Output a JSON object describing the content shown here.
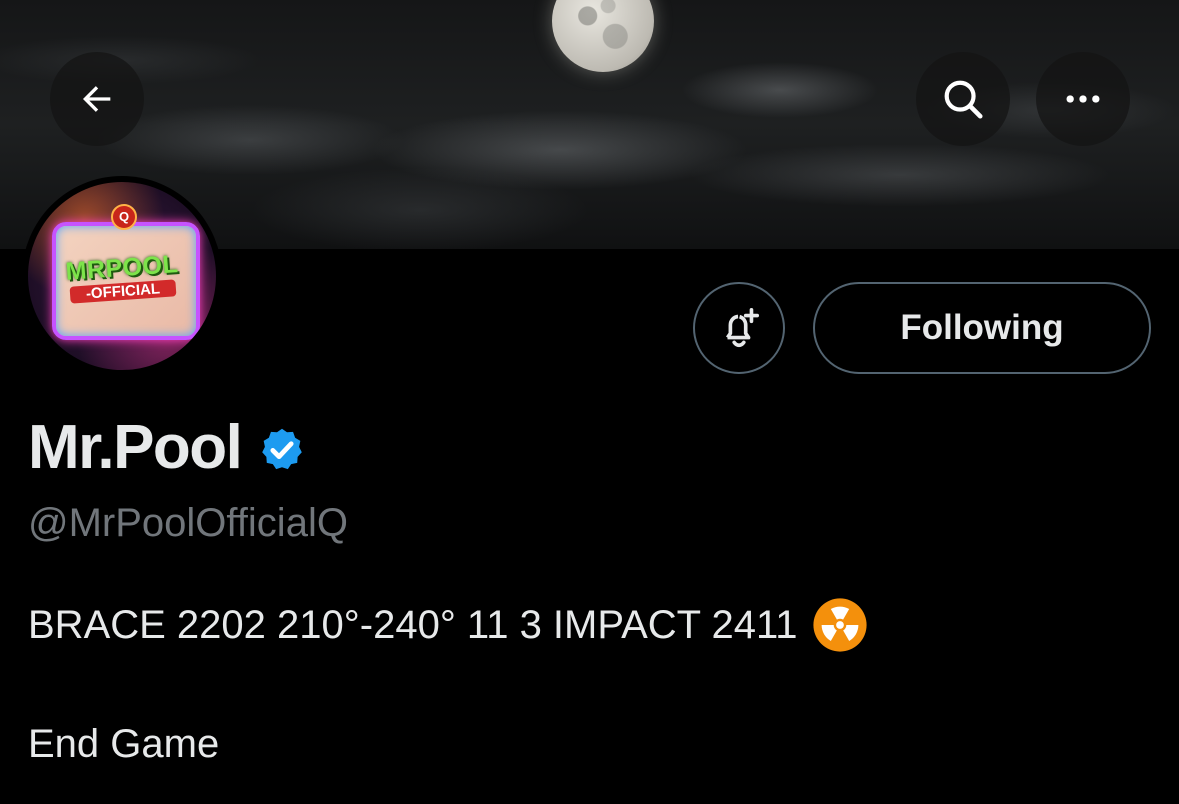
{
  "header": {
    "back_icon": "arrow-left-icon",
    "search_icon": "search-icon",
    "more_icon": "more-horizontal-icon"
  },
  "profile": {
    "avatar_logo_main": "MRPOOL",
    "avatar_logo_sub": "-OFFICIAL",
    "avatar_logo_badge": "Q",
    "display_name": "Mr.Pool",
    "verified": true,
    "handle": "@MrPoolOfficialQ",
    "bio_line1": "BRACE 2202 210°-240° 11 3 IMPACT 2411",
    "bio_emoji": "radioactive-icon",
    "bio_line2": "End Game"
  },
  "actions": {
    "notify_icon": "bell-plus-icon",
    "following_label": "Following"
  },
  "colors": {
    "background": "#000000",
    "text_primary": "#e7e9ea",
    "text_secondary": "#71767b",
    "border": "#536471",
    "verified_blue": "#1d9bf0",
    "emoji_orange": "#f4900c"
  }
}
